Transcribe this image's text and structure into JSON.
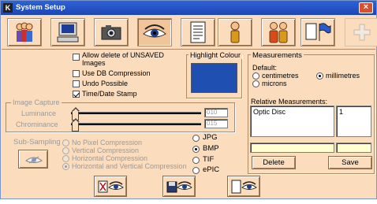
{
  "window": {
    "title": "System Setup",
    "icon_letter": "K",
    "close": "×"
  },
  "toolbar": {
    "icons": [
      "people-icon",
      "computer-icon",
      "camera-icon",
      "eye-icon",
      "document-icon",
      "person-icon",
      "persons-icon",
      "flag-icon",
      "plus-icon"
    ],
    "active": "eye-icon"
  },
  "options": {
    "allow_delete": {
      "label_line1": "Allow delete of UNSAVED",
      "label_line2": "Images",
      "checked": false
    },
    "use_db_compression": {
      "label": "Use DB Compression",
      "checked": false
    },
    "undo_possible": {
      "label": "Undo Possible",
      "checked": false
    },
    "time_date_stamp": {
      "label": "Time/Date Stamp",
      "checked": true
    }
  },
  "highlight": {
    "title": "Highlight Colour",
    "color": "#1f4fb0"
  },
  "measurements": {
    "title": "Measurements",
    "default_label": "Default:",
    "units": [
      "centimetres",
      "microns",
      "millimetres"
    ],
    "selected": "millimetres",
    "relative_label": "Relative Measurements:",
    "relative_name": "Optic Disc",
    "relative_value": "1",
    "delete_label": "Delete",
    "save_label": "Save"
  },
  "image_capture": {
    "title": "Image Capture",
    "luminance_label": "Luminance",
    "luminance_value": "010",
    "chrominance_label": "Chrominance",
    "chrominance_value": "015"
  },
  "subsampling": {
    "label": "Sub-Sampling",
    "options": [
      "No Pixel Compression",
      "Vertical Compression",
      "Horizontal Compression",
      "Horizontal and Vertical Compression"
    ],
    "selected": "Horizontal and Vertical Compression"
  },
  "formats": {
    "options": [
      "JPG",
      "BMP",
      "TIF",
      "ePIC"
    ],
    "selected": "BMP"
  }
}
